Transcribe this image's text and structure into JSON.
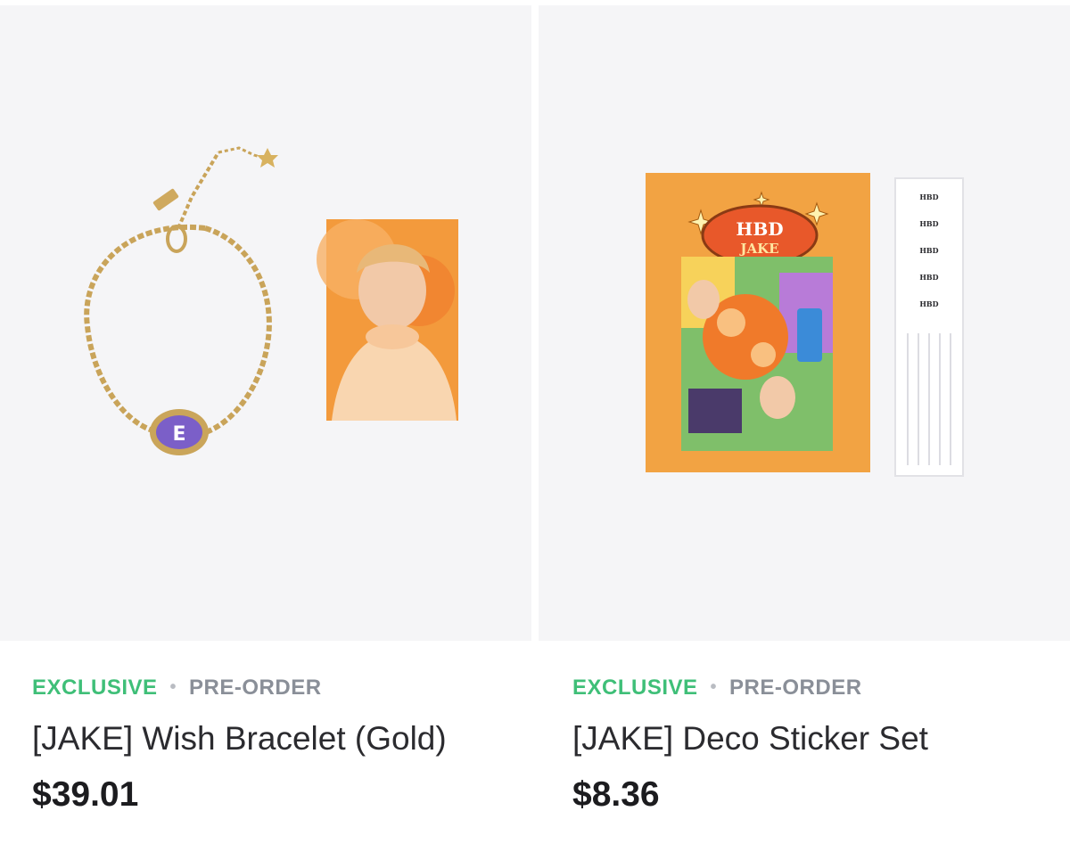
{
  "products": [
    {
      "badge_primary": "EXCLUSIVE",
      "badge_separator": "•",
      "badge_secondary": "PRE-ORDER",
      "name": "[JAKE] Wish Bracelet (Gold)",
      "price": "$39.01"
    },
    {
      "badge_primary": "EXCLUSIVE",
      "badge_separator": "•",
      "badge_secondary": "PRE-ORDER",
      "name": "[JAKE] Deco Sticker Set",
      "price": "$8.36",
      "image_text": {
        "card_line1": "HBD",
        "card_line2": "JAKE",
        "sheet_labels": [
          "HBD",
          "HBD",
          "HBD",
          "HBD",
          "HBD"
        ]
      }
    }
  ],
  "colors": {
    "exclusive": "#3fbf78",
    "preorder": "#8a8f98",
    "thumb_bg": "#f5f5f7",
    "accent_orange": "#f2a343"
  }
}
